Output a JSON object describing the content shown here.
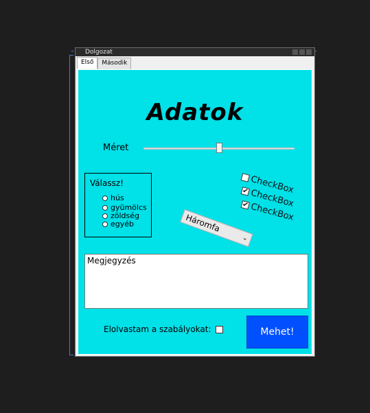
{
  "window": {
    "title": "Dolgozat"
  },
  "tabs": [
    {
      "label": "Első"
    },
    {
      "label": "Második"
    }
  ],
  "main": {
    "heading": "Adatok",
    "size_label": "Méret",
    "slider": {
      "value": 0.5
    },
    "radio_group": {
      "title": "Válassz!",
      "options": [
        {
          "label": "hús"
        },
        {
          "label": "gyümölcs"
        },
        {
          "label": "zöldség"
        },
        {
          "label": "egyéb"
        }
      ]
    },
    "checkboxes": [
      {
        "label": "CheckBox",
        "checked": false
      },
      {
        "label": "CheckBox",
        "checked": true
      },
      {
        "label": "CheckBox",
        "checked": true
      }
    ],
    "combo": {
      "selected": "Háromfa"
    },
    "notes": {
      "value": "Megjegyzés"
    },
    "agree_label": "Elolvastam a szabályokat:",
    "submit_label": "Mehet!"
  }
}
